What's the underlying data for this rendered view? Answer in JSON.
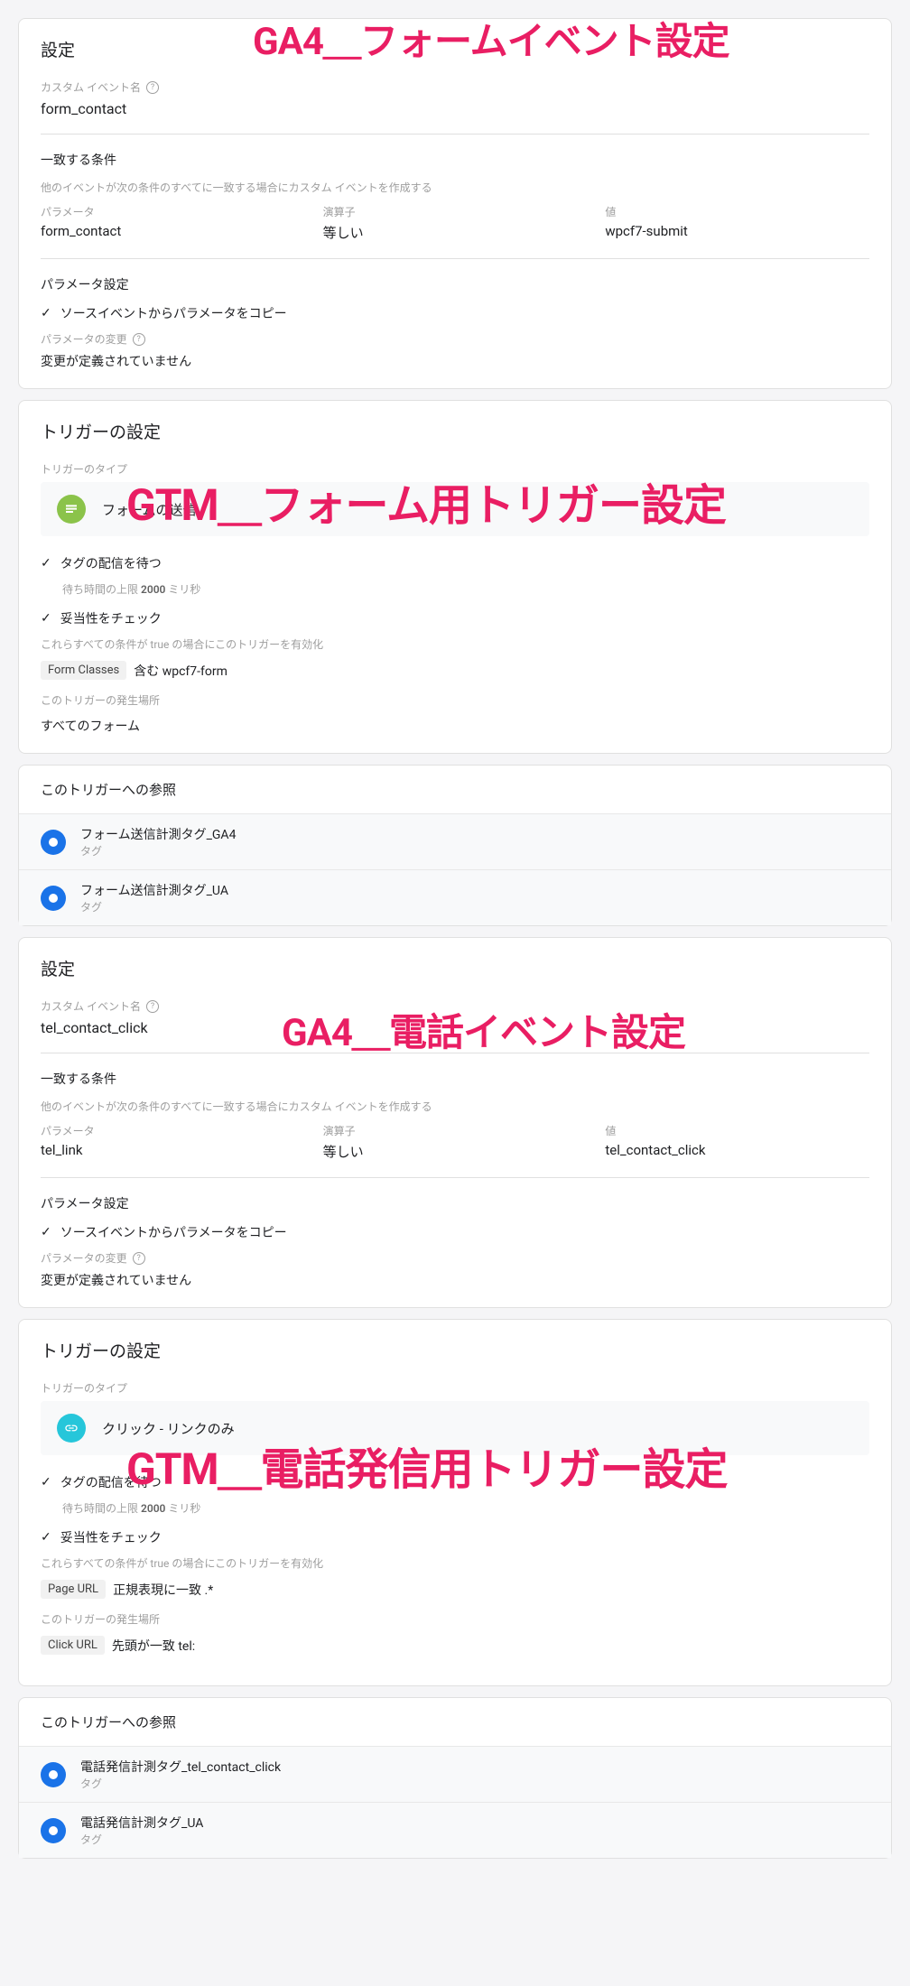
{
  "overlays": {
    "o1": "GA4＿フォームイベント設定",
    "o2": "GTM＿フォーム用トリガー設定",
    "o3": "GA4＿電話イベント設定",
    "o4": "GTM＿電話発信用トリガー設定"
  },
  "panel1": {
    "heading": "設定",
    "customEventLabel": "カスタム イベント名",
    "customEventValue": "form_contact",
    "matchHeading": "一致する条件",
    "matchDesc": "他のイベントが次の条件のすべてに一致する場合にカスタム イベントを作成する",
    "cols": {
      "param": "パラメータ",
      "op": "演算子",
      "val": "値"
    },
    "row": {
      "param": "form_contact",
      "op": "等しい",
      "val": "wpcf7-submit"
    },
    "paramHeading": "パラメータ設定",
    "copyParams": "ソースイベントからパラメータをコピー",
    "paramChangeLabel": "パラメータの変更",
    "paramChangeValue": "変更が定義されていません"
  },
  "panel2": {
    "heading": "トリガーの設定",
    "typeLabel": "トリガーのタイプ",
    "typeValue": "フォームの送信",
    "waitTag": "タグの配信を待つ",
    "waitText1": "待ち時間の上限 ",
    "waitText2": "2000",
    "waitText3": " ミリ秒",
    "validate": "妥当性をチェック",
    "enableLabel": "これらすべての条件が true の場合にこのトリガーを有効化",
    "chip1": "Form Classes",
    "chip2": "含む wpcf7-form",
    "locLabel": "このトリガーの発生場所",
    "locValue": "すべてのフォーム"
  },
  "ref1": {
    "heading": "このトリガーへの参照",
    "items": [
      {
        "title": "フォーム送信計測タグ_GA4",
        "sub": "タグ"
      },
      {
        "title": "フォーム送信計測タグ_UA",
        "sub": "タグ"
      }
    ]
  },
  "panel3": {
    "heading": "設定",
    "customEventLabel": "カスタム イベント名",
    "customEventValue": "tel_contact_click",
    "matchHeading": "一致する条件",
    "matchDesc": "他のイベントが次の条件のすべてに一致する場合にカスタム イベントを作成する",
    "cols": {
      "param": "パラメータ",
      "op": "演算子",
      "val": "値"
    },
    "row": {
      "param": "tel_link",
      "op": "等しい",
      "val": "tel_contact_click"
    },
    "paramHeading": "パラメータ設定",
    "copyParams": "ソースイベントからパラメータをコピー",
    "paramChangeLabel": "パラメータの変更",
    "paramChangeValue": "変更が定義されていません"
  },
  "panel4": {
    "heading": "トリガーの設定",
    "typeLabel": "トリガーのタイプ",
    "typeValue": "クリック - リンクのみ",
    "waitTag": "タグの配信を待つ",
    "waitText1": "待ち時間の上限 ",
    "waitText2": "2000",
    "waitText3": " ミリ秒",
    "validate": "妥当性をチェック",
    "enableLabel": "これらすべての条件が true の場合にこのトリガーを有効化",
    "chip1": "Page URL",
    "chip2": "正規表現に一致 .*",
    "locLabel": "このトリガーの発生場所",
    "locChip1": "Click URL",
    "locChip2": "先頭が一致 tel:"
  },
  "ref2": {
    "heading": "このトリガーへの参照",
    "items": [
      {
        "title": "電話発信計測タグ_tel_contact_click",
        "sub": "タグ"
      },
      {
        "title": "電話発信計測タグ_UA",
        "sub": "タグ"
      }
    ]
  }
}
